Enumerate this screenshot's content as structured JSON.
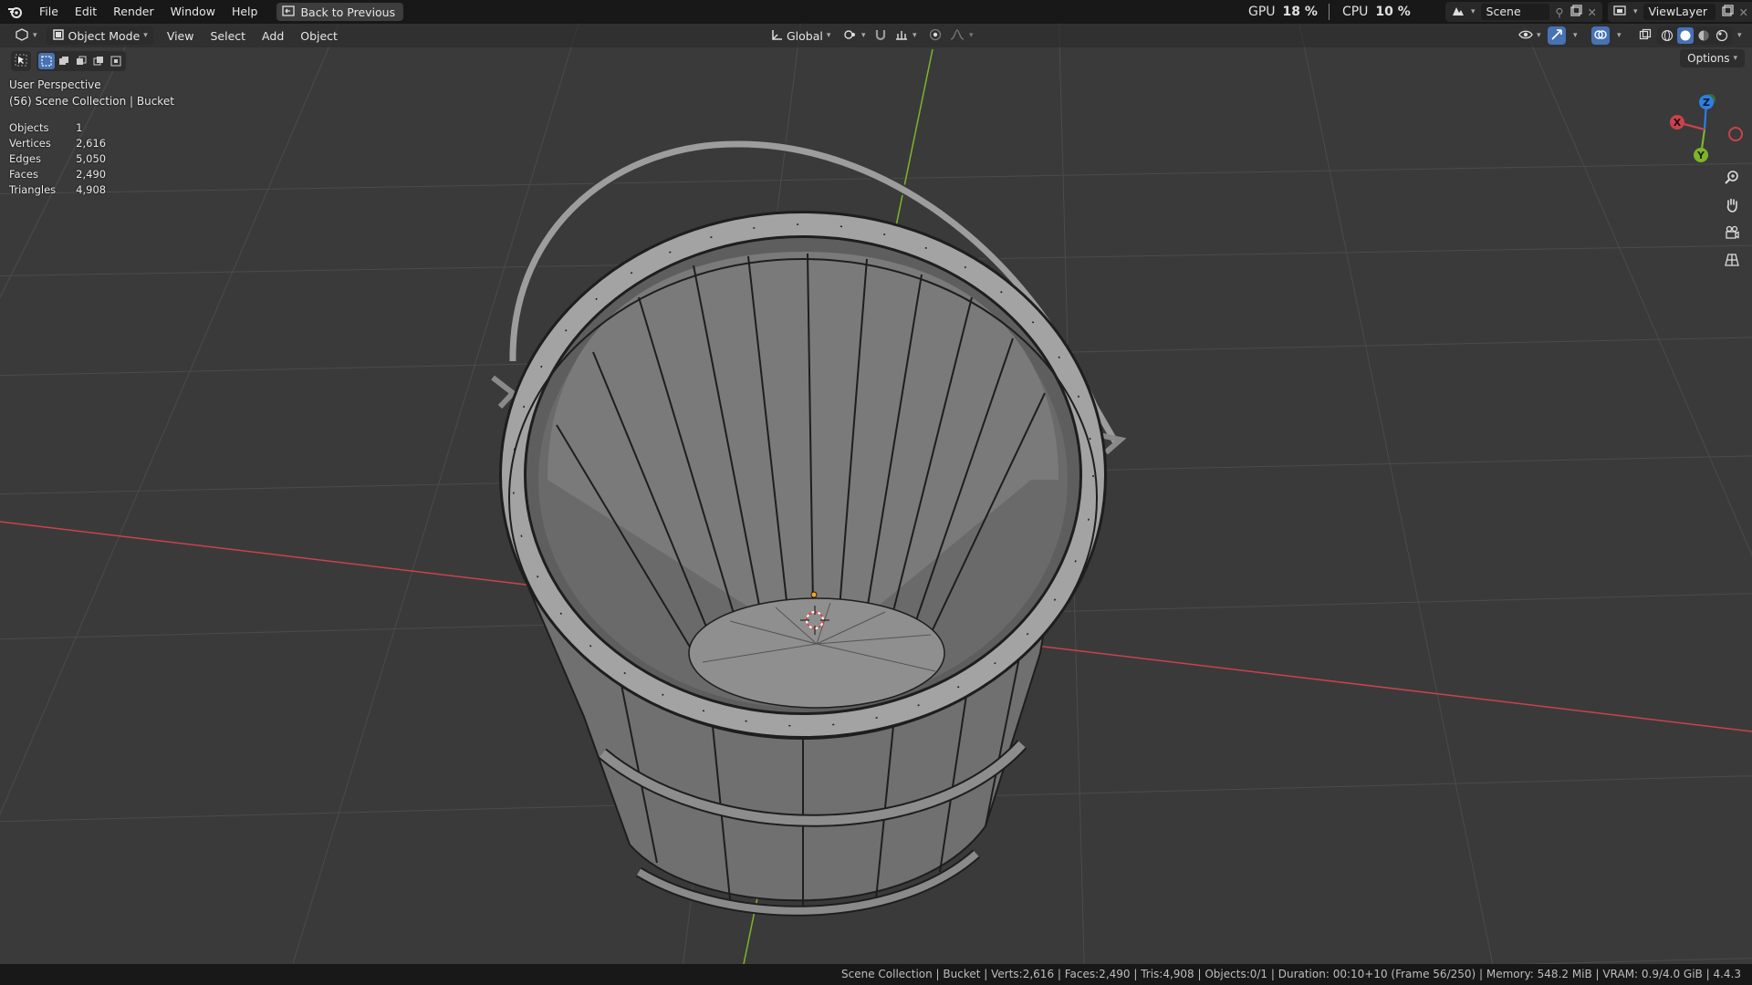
{
  "topbar": {
    "menu": [
      "File",
      "Edit",
      "Render",
      "Window",
      "Help"
    ],
    "back_button": "Back to Previous",
    "gpu_label": "GPU",
    "gpu_value": "18 %",
    "cpu_label": "CPU",
    "cpu_value": "10 %",
    "scene": "Scene",
    "view_layer": "ViewLayer"
  },
  "viewport_header": {
    "mode": "Object Mode",
    "menus": [
      "View",
      "Select",
      "Add",
      "Object"
    ],
    "orientation": "Global",
    "options": "Options"
  },
  "overlay": {
    "perspective": "User Perspective",
    "collection": "(56) Scene Collection | Bucket",
    "stats": [
      {
        "label": "Objects",
        "value": "1"
      },
      {
        "label": "Vertices",
        "value": "2,616"
      },
      {
        "label": "Edges",
        "value": "5,050"
      },
      {
        "label": "Faces",
        "value": "2,490"
      },
      {
        "label": "Triangles",
        "value": "4,908"
      }
    ]
  },
  "gizmo": {
    "x": "X",
    "y": "Y",
    "z": "Z"
  },
  "statusbar": {
    "text": "Scene Collection | Bucket | Verts:2,616 | Faces:2,490 | Tris:4,908 | Objects:0/1 | Duration: 00:10+10 (Frame 56/250) | Memory: 548.2 MiB | VRAM: 0.9/4.0 GiB | 4.4.3"
  },
  "colors": {
    "axis_x": "#c9424e",
    "axis_y": "#7fb32a",
    "gizmo_z": "#2d7fe0",
    "select_active": "#4772b3"
  }
}
